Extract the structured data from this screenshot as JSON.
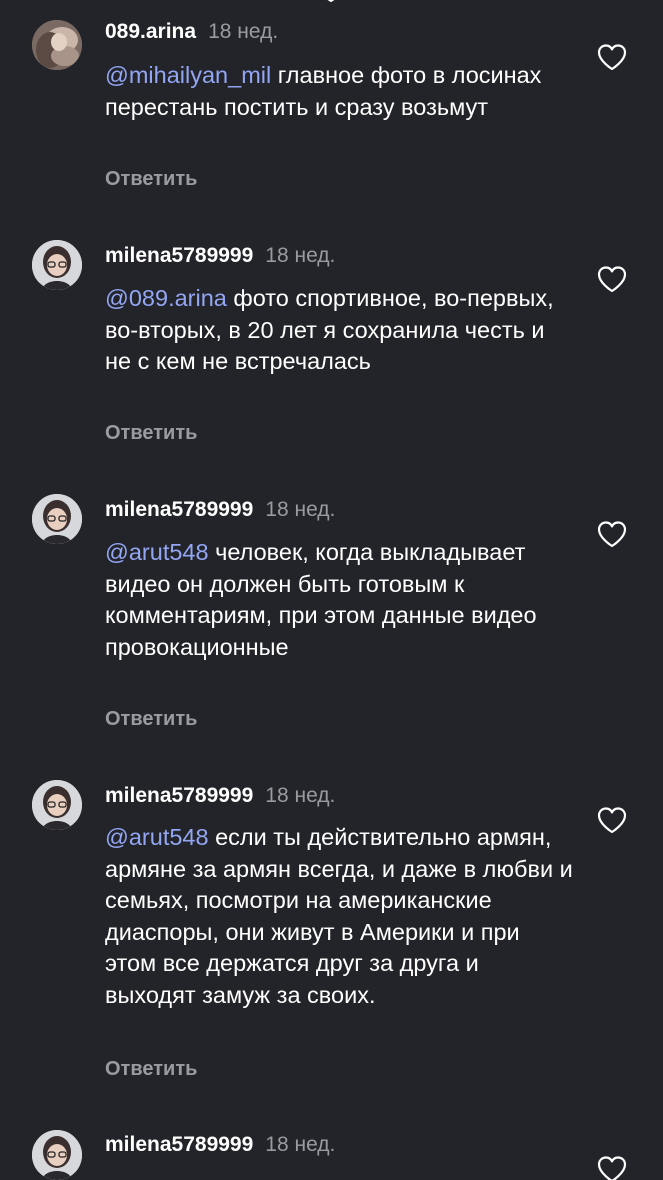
{
  "comments": [
    {
      "username": "089.arina",
      "time": "18 нед.",
      "mention": "@mihailyan_mil",
      "body": " главное фото в лосинах перестань постить и сразу возьмут",
      "reply_label": "Ответить",
      "avatar_icon": "avatar-photo",
      "like_icon": "heart-outline-icon"
    },
    {
      "username": "milena5789999",
      "time": "18 нед.",
      "mention": "@089.arina",
      "body": " фото спортивное, во-первых, во-вторых, в 20 лет я сохранила честь и не с кем не встречалась",
      "reply_label": "Ответить",
      "avatar_icon": "avatar-photo",
      "like_icon": "heart-outline-icon"
    },
    {
      "username": "milena5789999",
      "time": "18 нед.",
      "mention": "@arut548",
      "body": " человек, когда выкладывает видео он должен быть готовым к комментариям, при этом данные видео провокационные",
      "reply_label": "Ответить",
      "avatar_icon": "avatar-photo",
      "like_icon": "heart-outline-icon"
    },
    {
      "username": "milena5789999",
      "time": "18 нед.",
      "mention": "@arut548",
      "body": " если ты действительно армян, армяне за армян всегда, и даже в любви и семьях, посмотри на американские диаспоры, они живут в Америки и при этом все держатся друг за друга и выходят замуж за своих.",
      "reply_label": "Ответить",
      "avatar_icon": "avatar-photo",
      "like_icon": "heart-outline-icon"
    },
    {
      "username": "milena5789999",
      "time": "18 нед.",
      "avatar_icon": "avatar-photo",
      "like_icon": "heart-outline-icon"
    }
  ],
  "colors": {
    "background": "#232429",
    "text": "#ffffff",
    "secondary": "#9a9ba1",
    "mention": "#93a6f3"
  }
}
